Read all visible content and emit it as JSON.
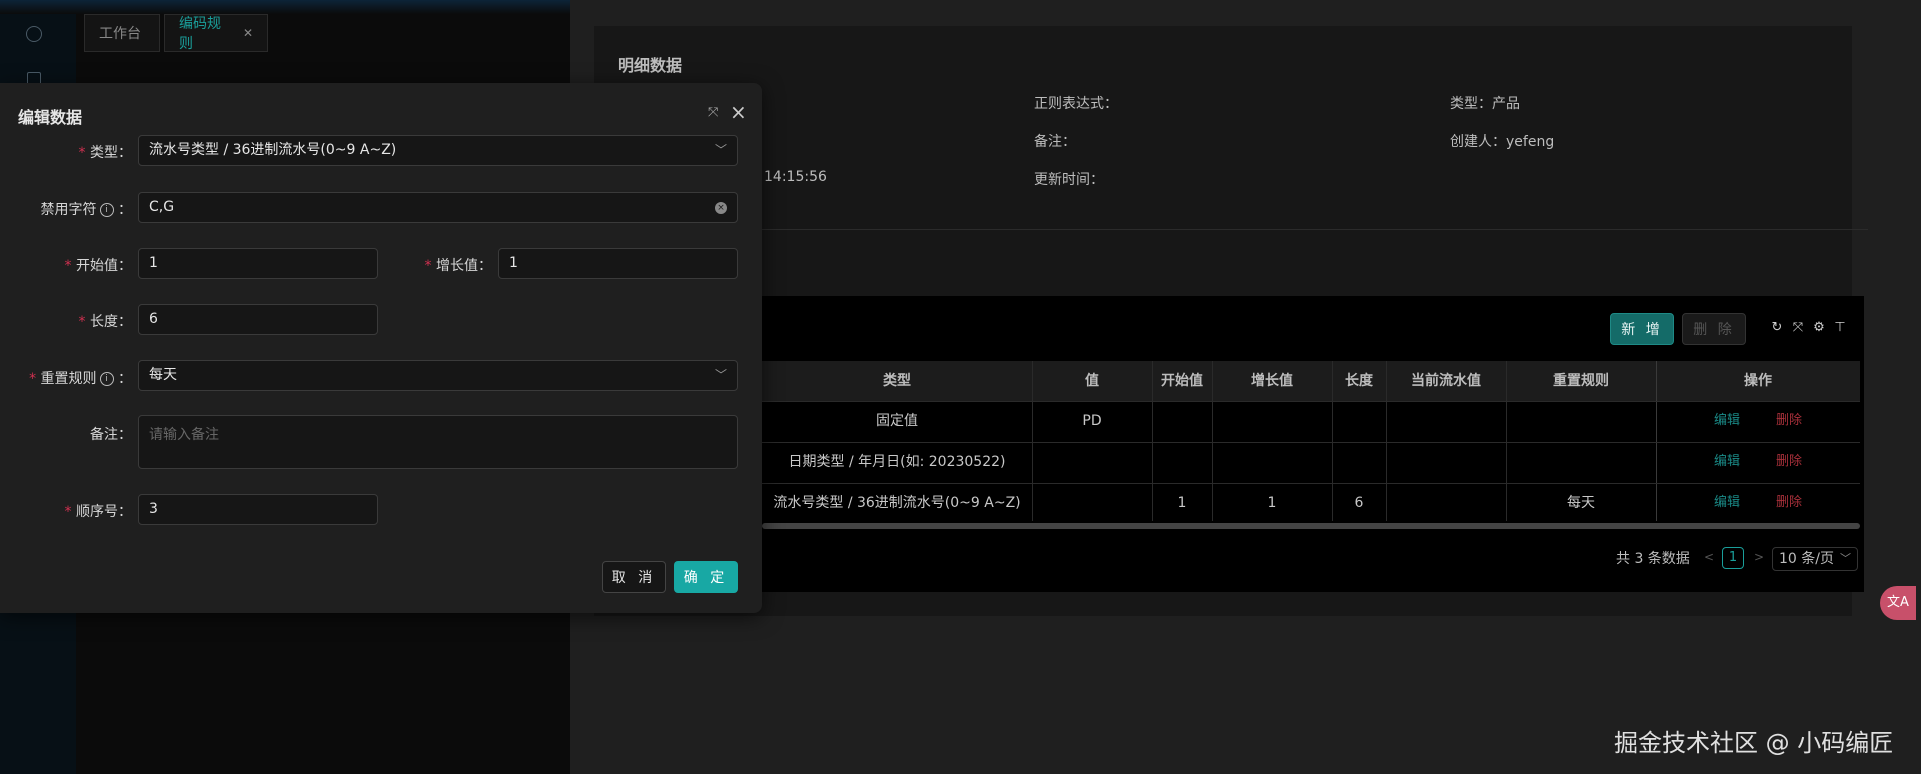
{
  "tabs": [
    {
      "label": "工作台"
    },
    {
      "label": "编码规则",
      "close": "✕"
    }
  ],
  "detail": {
    "title": "明细数据",
    "regex_label": "正则表达式：",
    "type_label": "类型：产品",
    "remark_label": "备注：",
    "creator_label": "创建人：yefeng",
    "created_time_fragment": "14:15:56",
    "update_label": "更新时间："
  },
  "table": {
    "add_button": "新 增",
    "delete_button": "删 除",
    "columns": [
      "类型",
      "值",
      "开始值",
      "增长值",
      "长度",
      "当前流水值",
      "重置规则",
      "操作"
    ],
    "rows": [
      {
        "type": "固定值",
        "value": "PD",
        "start": "",
        "step": "",
        "length": "",
        "current": "",
        "reset": "",
        "edit": "编辑",
        "delete": "删除"
      },
      {
        "type": "日期类型 / 年月日(如: 20230522)",
        "value": "",
        "start": "",
        "step": "",
        "length": "",
        "current": "",
        "reset": "",
        "edit": "编辑",
        "delete": "删除"
      },
      {
        "type": "流水号类型 / 36进制流水号(0~9 A~Z)",
        "value": "",
        "start": "1",
        "step": "1",
        "length": "6",
        "current": "",
        "reset": "每天",
        "edit": "编辑",
        "delete": "删除"
      }
    ]
  },
  "pager": {
    "total": "共 3 条数据",
    "prev": "<",
    "page": "1",
    "next": ">",
    "page_size": "10 条/页"
  },
  "float_button": "文A",
  "watermark": "掘金技术社区 @ 小码编匠",
  "modal": {
    "title": "编辑数据",
    "fields": {
      "type": {
        "label": "类型",
        "value": "流水号类型 / 36进制流水号(0~9 A~Z)"
      },
      "forbidden": {
        "label": "禁用字符",
        "value": "C,G"
      },
      "start": {
        "label": "开始值",
        "value": "1"
      },
      "step": {
        "label": "增长值",
        "value": "1"
      },
      "length": {
        "label": "长度",
        "value": "6"
      },
      "reset": {
        "label": "重置规则",
        "value": "每天"
      },
      "remark": {
        "label": "备注",
        "placeholder": "请输入备注"
      },
      "order": {
        "label": "顺序号",
        "value": "3"
      }
    },
    "cancel": "取 消",
    "ok": "确 定"
  },
  "colors": {
    "accent": "#18a8a4",
    "danger": "#a8303a",
    "required": "#d03050"
  }
}
